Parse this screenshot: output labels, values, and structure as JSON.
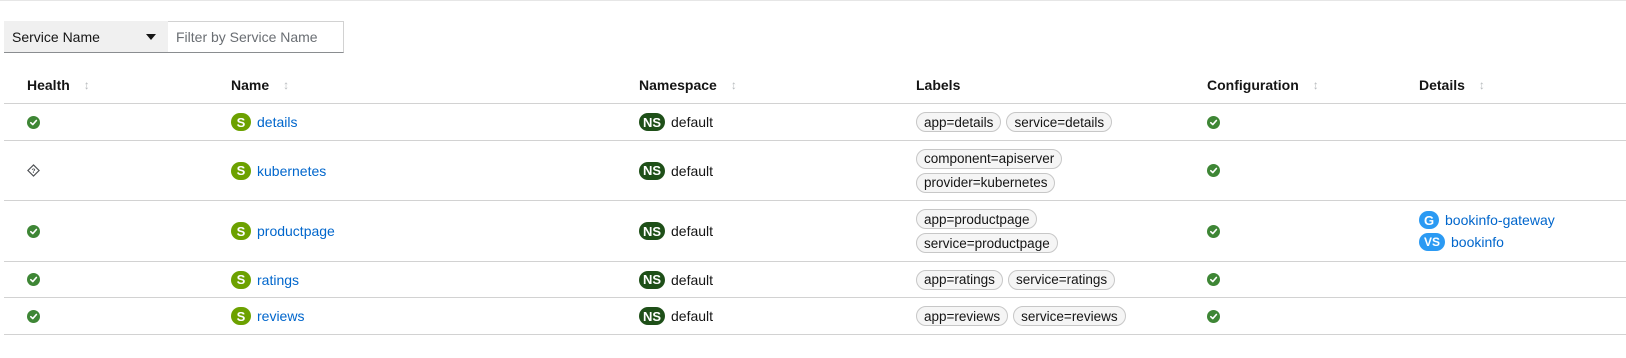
{
  "filter": {
    "select_label": "Service Name",
    "input_placeholder": "Filter by Service Name"
  },
  "columns": {
    "health": "Health",
    "name": "Name",
    "namespace": "Namespace",
    "labels": "Labels",
    "configuration": "Configuration",
    "details": "Details"
  },
  "badges": {
    "service": "S",
    "namespace": "NS",
    "gateway": "G",
    "virtual_service": "VS"
  },
  "colors": {
    "health_ok": "#3e8635",
    "service_badge": "#6ca100",
    "namespace_badge": "#1e4f18",
    "istio_badge": "#2b9af3",
    "link": "#0066cc"
  },
  "rows": [
    {
      "health": "healthy",
      "name": "details",
      "namespace": "default",
      "labels": [
        "app=details",
        "service=details"
      ],
      "configuration": "valid",
      "details": []
    },
    {
      "health": "unknown",
      "name": "kubernetes",
      "namespace": "default",
      "labels": [
        "component=apiserver",
        "provider=kubernetes"
      ],
      "configuration": "valid",
      "details": []
    },
    {
      "health": "healthy",
      "name": "productpage",
      "namespace": "default",
      "labels": [
        "app=productpage",
        "service=productpage"
      ],
      "configuration": "valid",
      "details": [
        {
          "badge": "G",
          "name": "bookinfo-gateway"
        },
        {
          "badge": "VS",
          "name": "bookinfo"
        }
      ]
    },
    {
      "health": "healthy",
      "name": "ratings",
      "namespace": "default",
      "labels": [
        "app=ratings",
        "service=ratings"
      ],
      "configuration": "valid",
      "details": []
    },
    {
      "health": "healthy",
      "name": "reviews",
      "namespace": "default",
      "labels": [
        "app=reviews",
        "service=reviews"
      ],
      "configuration": "valid",
      "details": []
    }
  ]
}
